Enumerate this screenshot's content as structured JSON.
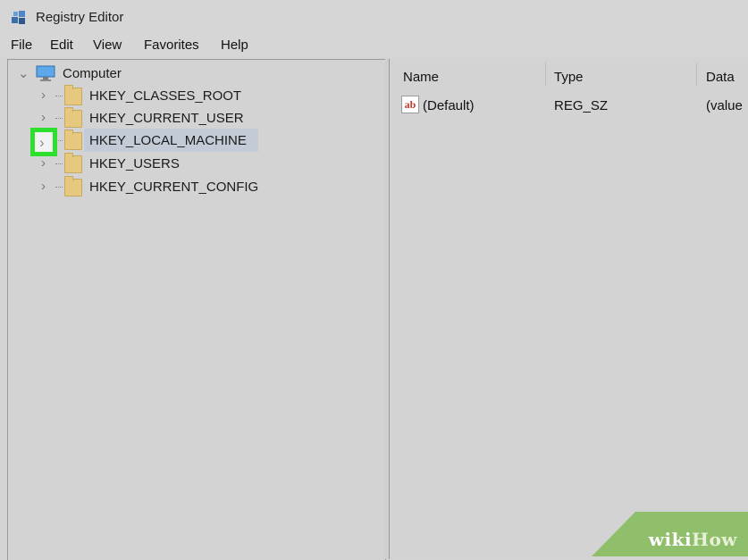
{
  "window": {
    "title": "Registry Editor",
    "app_icon": "registry-editor-icon"
  },
  "menu": [
    "File",
    "Edit",
    "View",
    "Favorites",
    "Help"
  ],
  "tree": {
    "root_label": "Computer",
    "root_icon": "computer-icon",
    "items": [
      {
        "label": "HKEY_CLASSES_ROOT"
      },
      {
        "label": "HKEY_CURRENT_USER"
      },
      {
        "label": "HKEY_LOCAL_MACHINE",
        "selected": true
      },
      {
        "label": "HKEY_USERS"
      },
      {
        "label": "HKEY_CURRENT_CONFIG"
      }
    ]
  },
  "list": {
    "columns": [
      "Name",
      "Type",
      "Data"
    ],
    "rows": [
      {
        "name": "(Default)",
        "type": "REG_SZ",
        "data": "(value"
      }
    ]
  },
  "watermark": {
    "part1": "wiki",
    "part2": "How"
  },
  "colors": {
    "highlight": "#2ee02e",
    "selection": "#c3ccd6"
  }
}
